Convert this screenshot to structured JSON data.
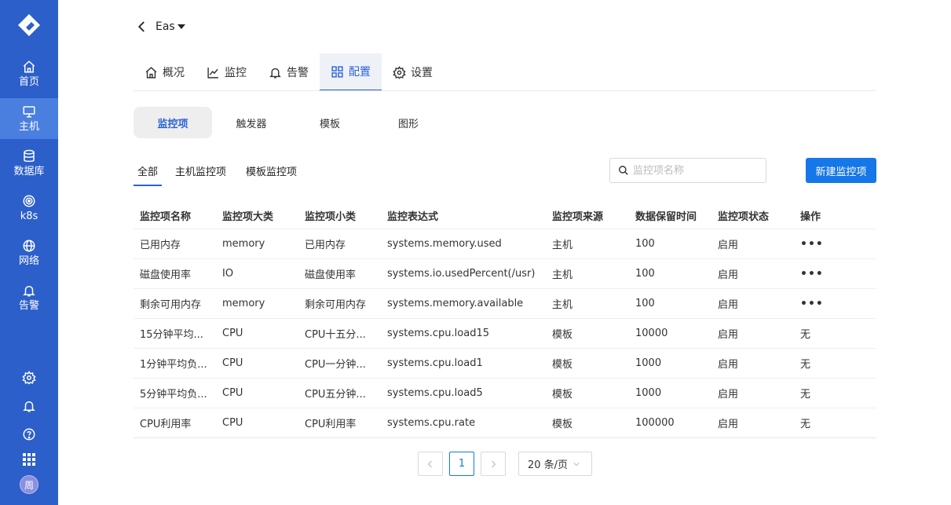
{
  "sidebar": {
    "items": [
      {
        "label": "首页",
        "icon": "home-icon"
      },
      {
        "label": "主机",
        "icon": "monitor-icon"
      },
      {
        "label": "数据库",
        "icon": "database-icon"
      },
      {
        "label": "k8s",
        "icon": "k8s-icon"
      },
      {
        "label": "网络",
        "icon": "globe-icon"
      },
      {
        "label": "告警",
        "icon": "bell-icon"
      }
    ],
    "active_index": 1,
    "avatar_text": "周"
  },
  "header": {
    "host_name": "Eas"
  },
  "tabs": [
    {
      "label": "概况",
      "icon": "home-icon"
    },
    {
      "label": "监控",
      "icon": "chart-line-icon"
    },
    {
      "label": "告警",
      "icon": "bell-icon"
    },
    {
      "label": "配置",
      "icon": "grid-icon"
    },
    {
      "label": "设置",
      "icon": "gear-icon"
    }
  ],
  "segments": [
    "监控项",
    "触发器",
    "模板",
    "图形"
  ],
  "filters": [
    "全部",
    "主机监控项",
    "模板监控项"
  ],
  "search": {
    "placeholder": "监控项名称"
  },
  "new_button": "新建监控项",
  "table": {
    "headers": [
      "监控项名称",
      "监控项大类",
      "监控项小类",
      "监控表达式",
      "监控项来源",
      "数据保留时间",
      "监控项状态",
      "操作"
    ],
    "rows": [
      [
        "已用内存",
        "memory",
        "已用内存",
        "systems.memory.used",
        "主机",
        "100",
        "启用",
        "•••"
      ],
      [
        "磁盘使用率",
        "IO",
        "磁盘使用率",
        "systems.io.usedPercent(/usr)",
        "主机",
        "100",
        "启用",
        "•••"
      ],
      [
        "剩余可用内存",
        "memory",
        "剩余可用内存",
        "systems.memory.available",
        "主机",
        "100",
        "启用",
        "•••"
      ],
      [
        "15分钟平均...",
        "CPU",
        "CPU十五分...",
        "systems.cpu.load15",
        "模板",
        "10000",
        "启用",
        "无"
      ],
      [
        "1分钟平均负...",
        "CPU",
        "CPU一分钟...",
        "systems.cpu.load1",
        "模板",
        "1000",
        "启用",
        "无"
      ],
      [
        "5分钟平均负...",
        "CPU",
        "CPU五分钟...",
        "systems.cpu.load5",
        "模板",
        "1000",
        "启用",
        "无"
      ],
      [
        "CPU利用率",
        "CPU",
        "CPU利用率",
        "systems.cpu.rate",
        "模板",
        "100000",
        "启用",
        "无"
      ]
    ]
  },
  "pagination": {
    "current_page": "1",
    "page_size": "20 条/页"
  },
  "colors": {
    "sidebar": "#2c5fc9",
    "sidebar_active": "#4a7fdf",
    "accent": "#2a62d8",
    "button": "#1677e8"
  }
}
